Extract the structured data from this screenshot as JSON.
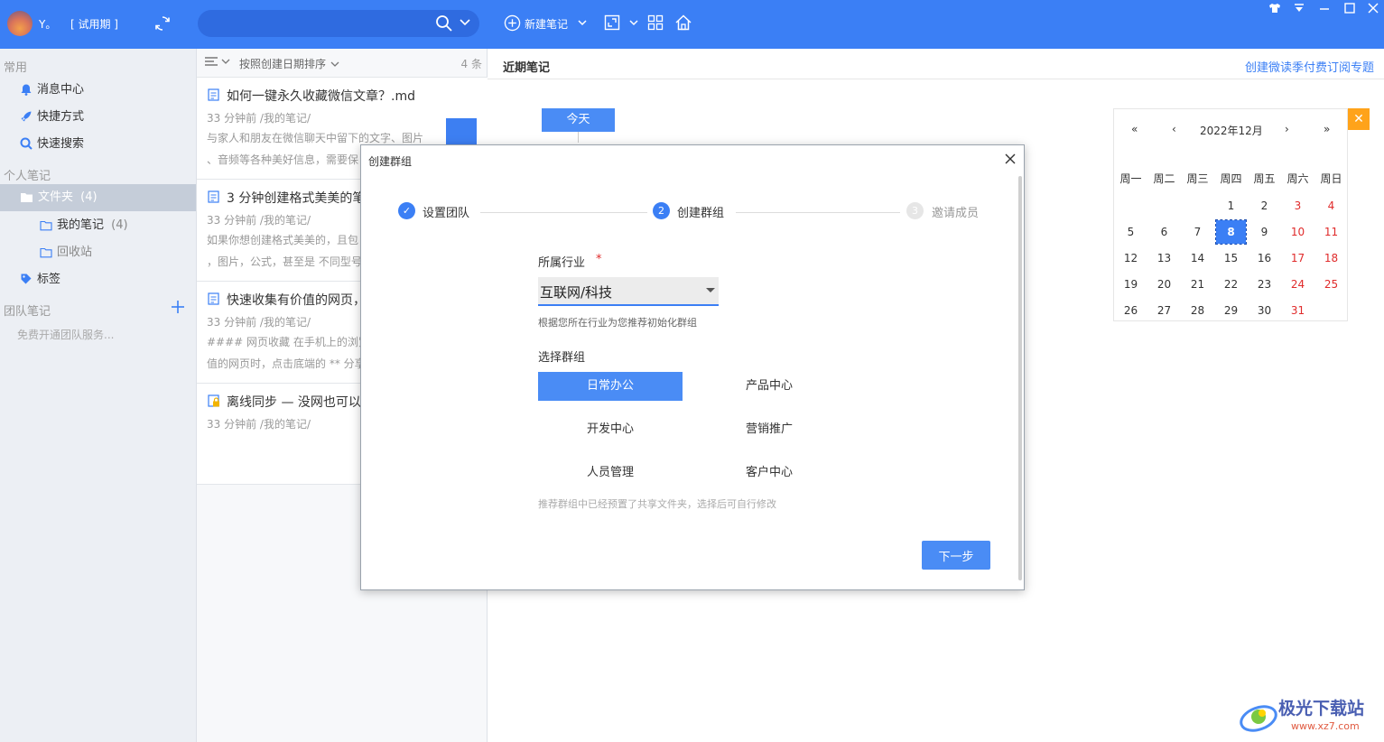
{
  "topbar": {
    "username": "Y。",
    "trial_label": "[ 试用期 ]",
    "search_placeholder": "",
    "new_note_label": "新建笔记"
  },
  "sidebar": {
    "section_common": "常用",
    "items_common": [
      "消息中心",
      "快捷方式",
      "快速搜索"
    ],
    "section_personal": "个人笔记",
    "folder_label": "文件夹",
    "folder_count": "(4)",
    "my_notes_label": "我的笔记",
    "my_notes_count": "(4)",
    "recycle_label": "回收站",
    "tags_label": "标签",
    "section_team": "团队笔记",
    "team_promo": "免费开通团队服务..."
  },
  "notelist": {
    "sort_label": "按照创建日期排序",
    "count_label": "4 条",
    "notes": [
      {
        "title": "如何一键永久收藏微信文章？.md",
        "meta": "33 分钟前   /我的笔记/",
        "summary1": "与家人和朋友在微信聊天中留下的文字、图片",
        "summary2": "、音频等各种美好信息，需要保"
      },
      {
        "title": "3 分钟创建格式美美的笔",
        "meta": "33 分钟前   /我的笔记/",
        "summary1": "如果你想创建格式美美的，且包",
        "summary2": "，图片，公式，甚至是 不同型号"
      },
      {
        "title": "快速收集有价值的网页，",
        "meta": "33 分钟前   /我的笔记/",
        "summary1": "#### 网页收藏 在手机上的浏览",
        "summary2": "值的网页时，点击底端的 ** 分享"
      },
      {
        "title": "离线同步 — 没网也可以",
        "meta": "33 分钟前   /我的笔记/",
        "summary1": "",
        "summary2": ""
      }
    ]
  },
  "main": {
    "recent_title": "近期笔记",
    "topic_link": "创建微读季付费订阅专题",
    "today_button": "今天"
  },
  "calendar": {
    "prev_year": "«",
    "prev_month": "‹",
    "month_label": "2022年12月",
    "next_month": "›",
    "next_year": "»",
    "weekdays": [
      "周一",
      "周二",
      "周三",
      "周四",
      "周五",
      "周六",
      "周日"
    ],
    "weeks": [
      [
        "",
        "",
        "",
        "1",
        "2",
        "3",
        "4"
      ],
      [
        "5",
        "6",
        "7",
        "8",
        "9",
        "10",
        "11"
      ],
      [
        "12",
        "13",
        "14",
        "15",
        "16",
        "17",
        "18"
      ],
      [
        "19",
        "20",
        "21",
        "22",
        "23",
        "24",
        "25"
      ],
      [
        "26",
        "27",
        "28",
        "29",
        "30",
        "31",
        ""
      ]
    ],
    "selected_day": "8",
    "weekend_color": "#e02b2b",
    "selected_color": "#3b7ff5",
    "close_label": "✕"
  },
  "dialog": {
    "title": "创建群组",
    "steps": [
      {
        "label": "设置团队",
        "number": "✓",
        "state": "done"
      },
      {
        "label": "创建群组",
        "number": "2",
        "state": "active"
      },
      {
        "label": "邀请成员",
        "number": "3",
        "state": "pending"
      }
    ],
    "industry_label": "所属行业",
    "required_mark": "*",
    "industry_value": "互联网/科技",
    "industry_hint": "根据您所在行业为您推荐初始化群组",
    "group_label": "选择群组",
    "groups": [
      "日常办公",
      "产品中心",
      "开发中心",
      "营销推广",
      "人员管理",
      "客户中心"
    ],
    "selected_group": "日常办公",
    "group_hint": "推荐群组中已经预置了共享文件夹，选择后可自行修改",
    "next_button": "下一步"
  },
  "watermark": {
    "text": "极光下载站",
    "url": "www.xz7.com"
  },
  "colors": {
    "accent": "#3b7ff5",
    "annotation_arrow": "#e8231f"
  }
}
